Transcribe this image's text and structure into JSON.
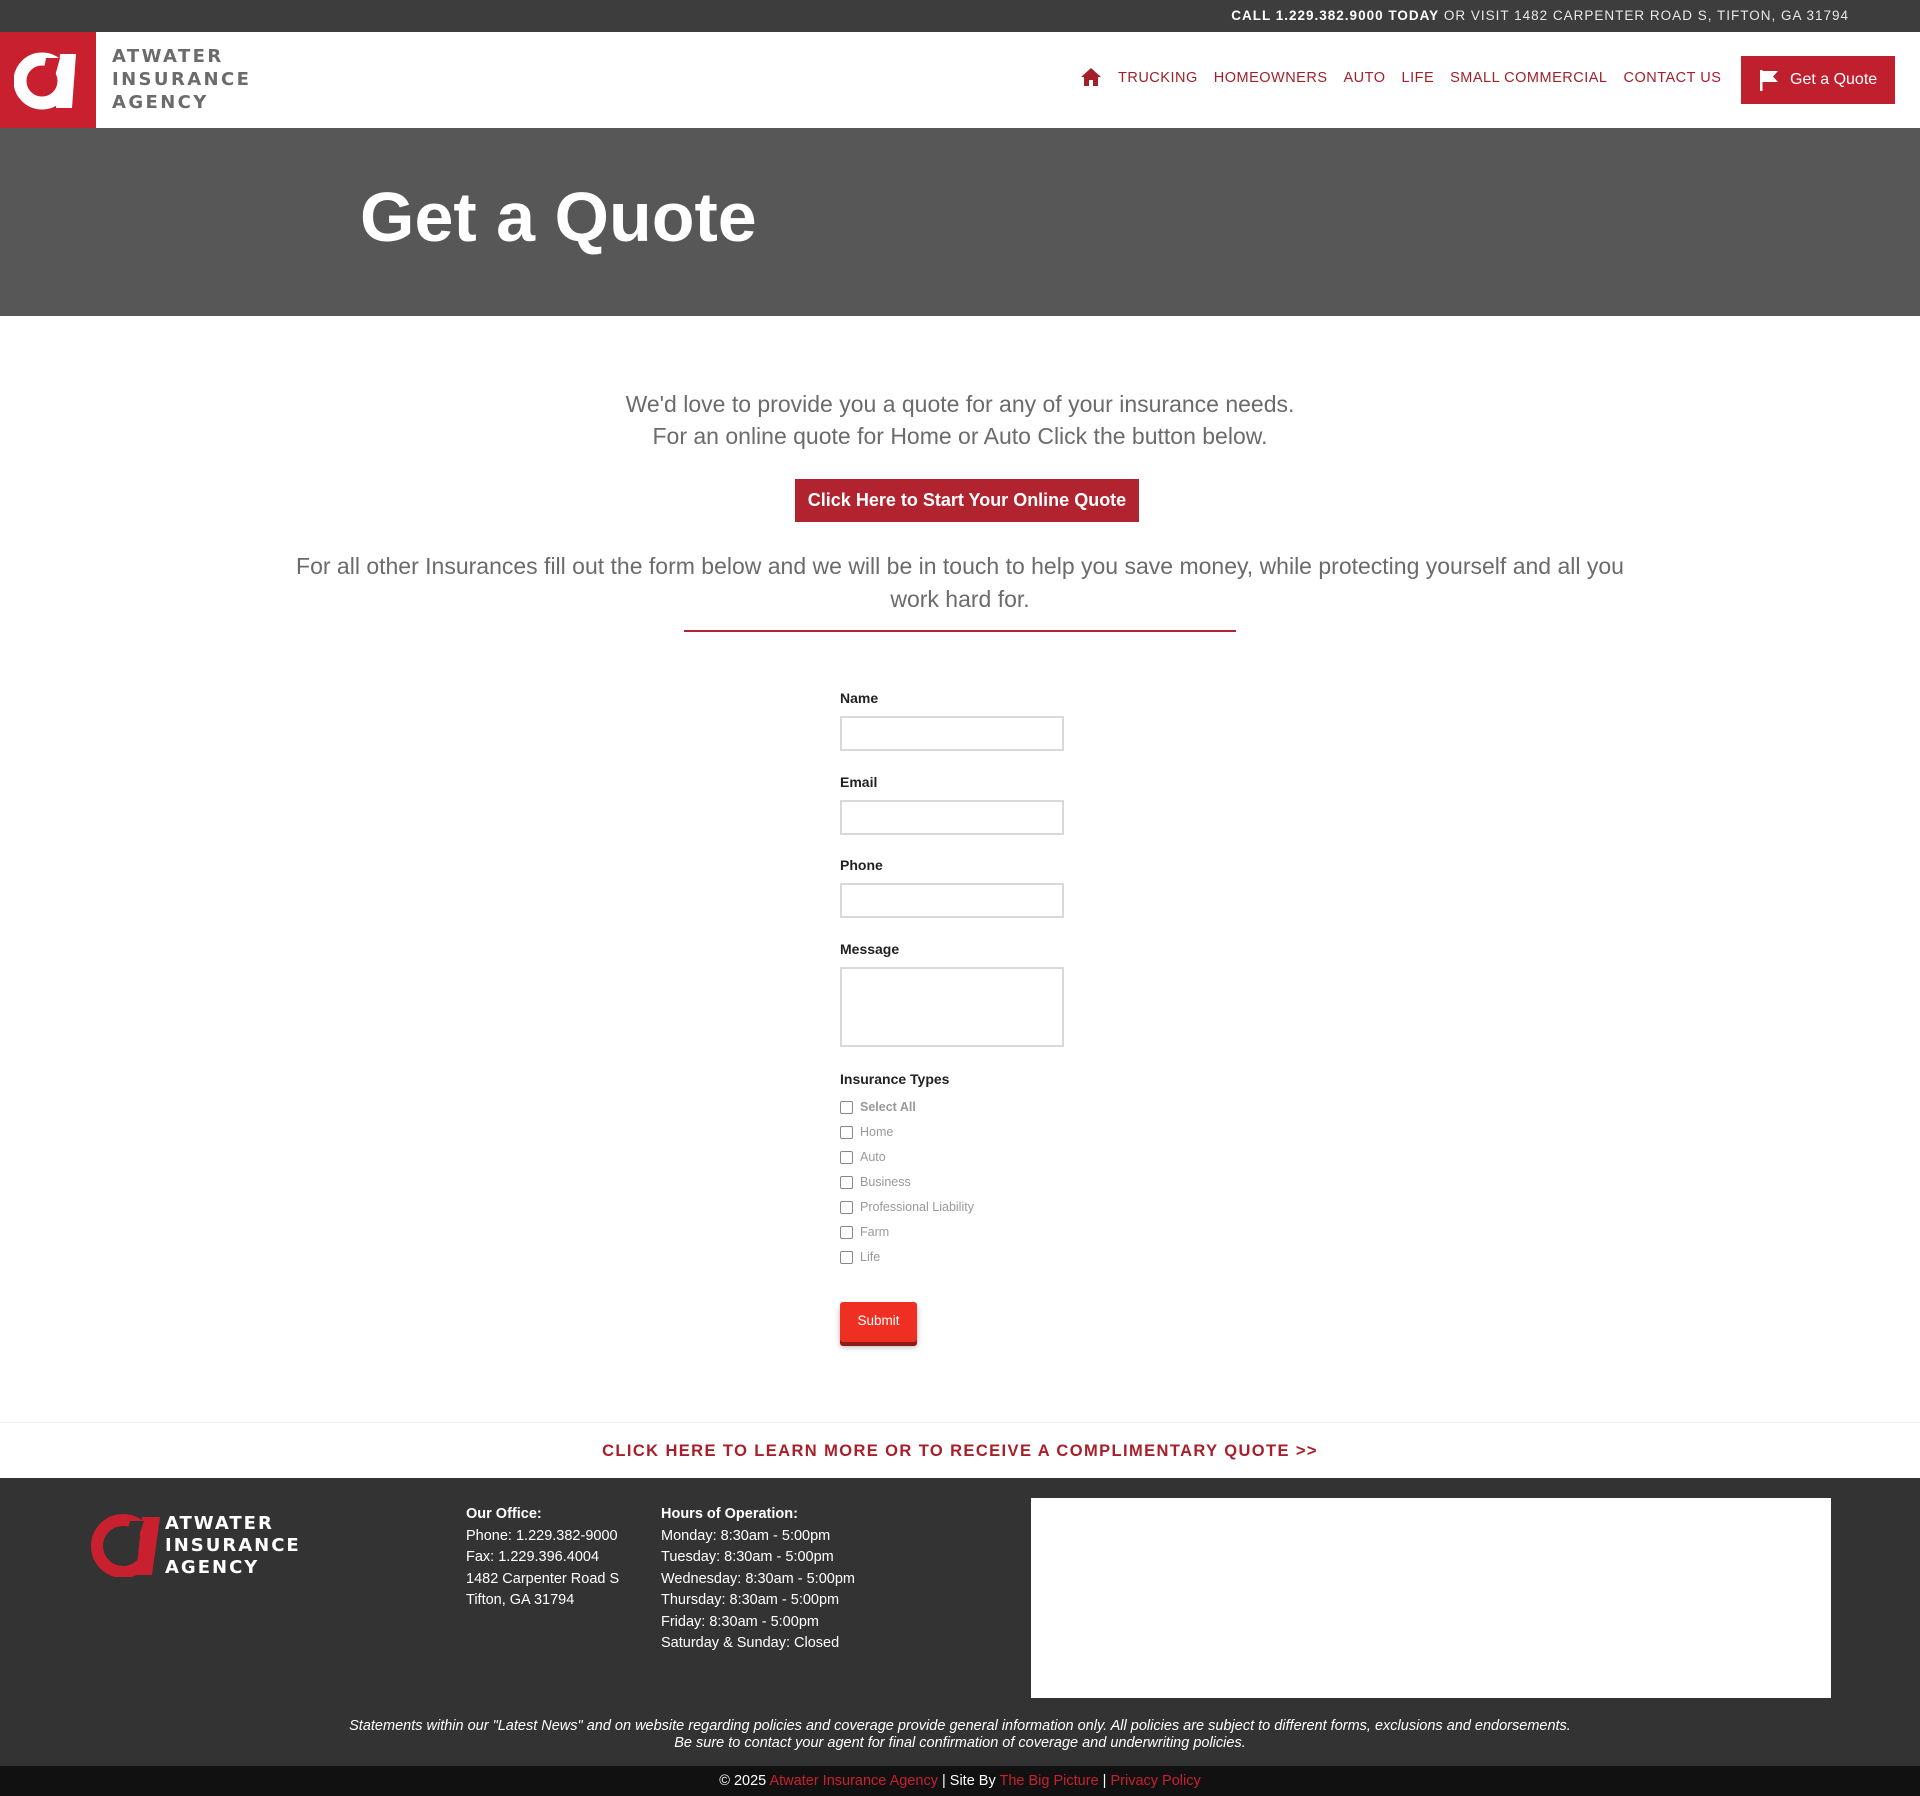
{
  "topbar": {
    "call_label": "CALL 1.229.382.9000 TODAY",
    "visit_text": "OR VISIT 1482 CARPENTER ROAD S, TIFTON, GA 31794"
  },
  "header": {
    "logo_lines": [
      "ATWATER",
      "INSURANCE",
      "AGENCY"
    ],
    "nav": [
      "TRUCKING",
      "HOMEOWNERS",
      "AUTO",
      "LIFE",
      "SMALL COMMERCIAL",
      "CONTACT US"
    ],
    "quote_button": "Get a Quote",
    "home_icon": "home-icon",
    "flag_icon": "flag-icon"
  },
  "hero": {
    "title": "Get a Quote"
  },
  "intro": {
    "line1": "We'd love to provide you a quote for any of your insurance needs.",
    "line2": "For an online quote for Home or Auto Click the button below.",
    "online_button": "Click Here to Start Your Online Quote",
    "other_text": "For all other Insurances fill out the form below and we will be in touch to help you save money, while protecting yourself and all you work hard for."
  },
  "form": {
    "name_label": "Name",
    "email_label": "Email",
    "phone_label": "Phone",
    "message_label": "Message",
    "name_value": "",
    "email_value": "",
    "phone_value": "",
    "message_value": "",
    "types_label": "Insurance Types",
    "types": [
      "Select All",
      "Home",
      "Auto",
      "Business",
      "Professional Liability",
      "Farm",
      "Life"
    ],
    "submit": "Submit"
  },
  "cta": {
    "text": "CLICK HERE TO LEARN MORE OR TO RECEIVE A COMPLIMENTARY QUOTE >>"
  },
  "footer": {
    "logo_lines": [
      "ATWATER",
      "INSURANCE",
      "AGENCY"
    ],
    "office_heading": "Our Office:",
    "office_lines": [
      "Phone: 1.229.382-9000",
      "Fax: 1.229.396.4004",
      "1482 Carpenter Road S",
      "Tifton, GA 31794"
    ],
    "hours_heading": "Hours of Operation:",
    "hours_lines": [
      "Monday: 8:30am - 5:00pm",
      "Tuesday: 8:30am - 5:00pm",
      "Wednesday: 8:30am - 5:00pm",
      "Thursday: 8:30am - 5:00pm",
      "Friday: 8:30am - 5:00pm",
      "Saturday & Sunday: Closed"
    ],
    "disclaimer_line1": "Statements within our \"Latest News\" and on website regarding policies and coverage provide general information only. All policies are subject to different forms, exclusions and endorsements.",
    "disclaimer_line2": "Be sure to contact your agent for final confirmation of coverage and underwriting policies."
  },
  "bottom": {
    "copyright": "© 2025",
    "agency_link": "Atwater Insurance Agency",
    "site_by": "| Site By",
    "site_link": "The Big Picture",
    "sep": "|",
    "privacy_link": "Privacy Policy"
  },
  "colors": {
    "brand_red": "#c8202f",
    "dark_gray": "#575757",
    "footer_bg": "#333333"
  }
}
